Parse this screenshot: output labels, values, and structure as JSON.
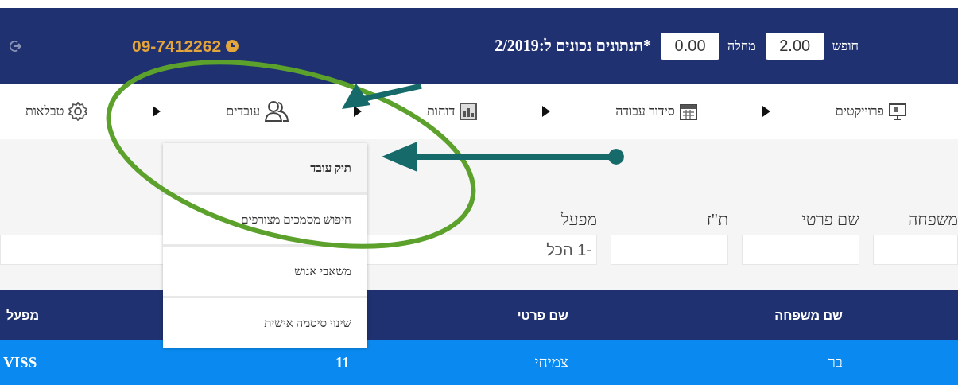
{
  "header": {
    "fields": [
      {
        "label": "חופש",
        "value": "2.00"
      },
      {
        "label": "מחלה",
        "value": "0.00"
      }
    ],
    "note": "*הנתונים נכונים ל:2/2019",
    "phone": "09-7412262"
  },
  "nav": [
    {
      "label": "פרוייקטים",
      "kind": "projector"
    },
    {
      "label": "סידור עבודה",
      "kind": "calendar"
    },
    {
      "label": "דוחות",
      "kind": "report"
    },
    {
      "label": "עובדים",
      "kind": "people",
      "expanded": true
    },
    {
      "label": "טבלאות",
      "kind": "gear"
    }
  ],
  "menu": {
    "items": [
      {
        "label": "תיק עובד",
        "selected": true
      },
      {
        "label": "חיפוש מסמכים מצורפים",
        "selected": false
      },
      {
        "label": "משאבי אנוש",
        "selected": false
      },
      {
        "label": "שינוי סיסמה אישית",
        "selected": false
      }
    ]
  },
  "filters": [
    {
      "label": "משפחה"
    },
    {
      "label": "שם פרטי"
    },
    {
      "label": "ת\"ז"
    },
    {
      "label": "מפעל",
      "value": "-1 הכל"
    }
  ],
  "table": {
    "columns": [
      "שם משפחה",
      "שם פרטי",
      "",
      "מפעל"
    ],
    "rows": [
      {
        "cells": [
          "בר",
          "צמיחי",
          "11",
          "VISS"
        ],
        "selected": true
      }
    ]
  }
}
